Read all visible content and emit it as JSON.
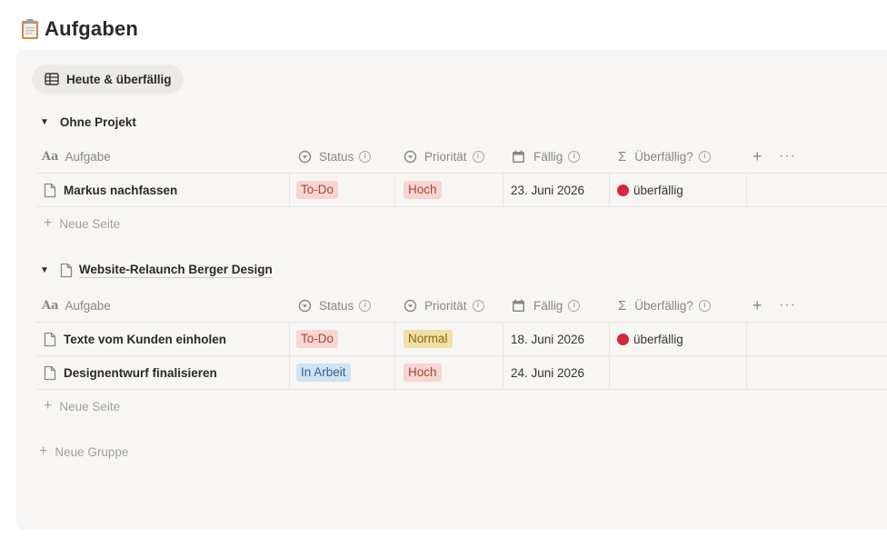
{
  "page": {
    "title": "Aufgaben",
    "icon": "clipboard-icon"
  },
  "view": {
    "tab_label": "Heute & überfällig",
    "tab_icon": "table-icon"
  },
  "columns": {
    "aufgabe": "Aufgabe",
    "status": "Status",
    "prioritaet": "Priorität",
    "faellig": "Fällig",
    "ueberfaellig": "Überfällig?"
  },
  "groups": [
    {
      "name": "Ohne Projekt",
      "rows": [
        {
          "aufgabe": "Markus nachfassen",
          "status": "To-Do",
          "prioritaet": "Hoch",
          "faellig": "23. Juni 2026",
          "ueberfaellig": "überfällig"
        }
      ],
      "new_page": "Neue Seite"
    },
    {
      "name": "Website-Relaunch Berger Design",
      "rows": [
        {
          "aufgabe": "Texte vom Kunden einholen",
          "status": "To-Do",
          "prioritaet": "Normal",
          "faellig": "18. Juni 2026",
          "ueberfaellig": "überfällig"
        },
        {
          "aufgabe": "Designentwurf finalisieren",
          "status": "In Arbeit",
          "prioritaet": "Hoch",
          "faellig": "24. Juni 2026",
          "ueberfaellig": ""
        }
      ],
      "new_page": "Neue Seite"
    }
  ],
  "new_group": "Neue Gruppe",
  "colors": {
    "todo_bg": "#f7d5d1",
    "inarbeit_bg": "#cfe3f3",
    "hoch_bg": "#f7d5d1",
    "normal_bg": "#f0e0a6",
    "overdue_dot": "#d8263a"
  }
}
